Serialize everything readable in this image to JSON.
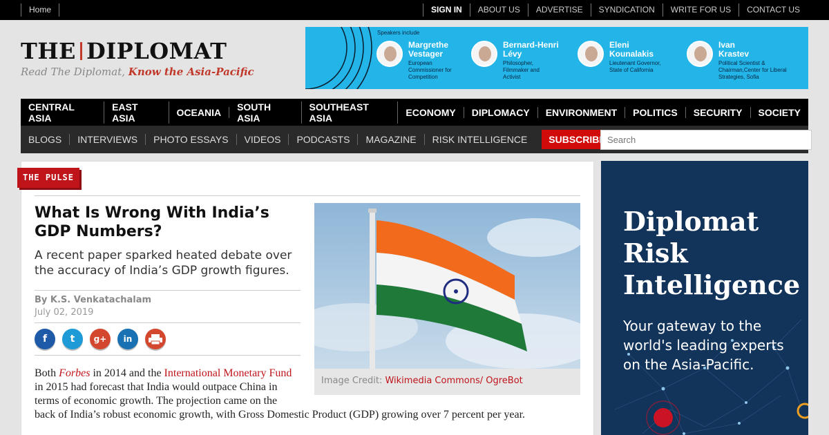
{
  "topbar": {
    "home": "Home",
    "links": [
      "SIGN IN",
      "ABOUT US",
      "ADVERTISE",
      "SYNDICATION",
      "WRITE FOR US",
      "CONTACT US"
    ]
  },
  "logo": {
    "word_left": "THE",
    "word_right": "DIPLOMAT",
    "tagline_plain": "Read The Diplomat, ",
    "tagline_bold": "Know the Asia-Pacific"
  },
  "top_ad": {
    "header": "Speakers include",
    "speakers": [
      {
        "name": "Margrethe Vestager",
        "role": "European Commissioner for Competition"
      },
      {
        "name": "Bernard-Henri Lévy",
        "role": "Philosopher, Filmmaker and Activist"
      },
      {
        "name": "Eleni Kounalakis",
        "role": "Lieutenant Governor, State of California"
      },
      {
        "name": "Ivan Krastev",
        "role": "Political Scientist & Chairman,Center for Liberal Strategies, Sofia"
      }
    ]
  },
  "nav_primary": [
    "CENTRAL ASIA",
    "EAST ASIA",
    "OCEANIA",
    "SOUTH ASIA",
    "SOUTHEAST ASIA",
    "ECONOMY",
    "DIPLOMACY",
    "ENVIRONMENT",
    "POLITICS",
    "SECURITY",
    "SOCIETY"
  ],
  "nav_secondary": [
    "BLOGS",
    "INTERVIEWS",
    "PHOTO ESSAYS",
    "VIDEOS",
    "PODCASTS",
    "MAGAZINE",
    "RISK INTELLIGENCE"
  ],
  "subscribe_label": "SUBSCRIBE",
  "search": {
    "placeholder": "Search"
  },
  "article": {
    "section": "THE PULSE",
    "title": "What Is Wrong With India’s GDP Numbers?",
    "subtitle": "A recent paper sparked heated debate over the accuracy of India’s GDP growth figures.",
    "author": "By K.S. Venkatachalam",
    "date": "July 02, 2019",
    "share_icons": [
      "f",
      "t",
      "g+",
      "in",
      "print"
    ],
    "caption_label": "Image Credit: ",
    "caption_link": "Wikimedia Commons/ OgreBot",
    "body": {
      "p1_a": "Both ",
      "p1_forbes": "Forbes",
      "p1_b": " in 2014 and the ",
      "p1_imf": "International Monetary Fund",
      "p1_c": " in 2015 had forecast that India would outpace China in terms of economic growth. The projection came on the",
      "p1_d": "back of India’s robust economic growth, with Gross Domestic Product (GDP) growing over 7 percent per year."
    }
  },
  "side_ad": {
    "headline_1": "Diplomat",
    "headline_2": "Risk",
    "headline_3": "Intelligence",
    "sub": "Your gateway to the world's leading experts on the Asia-Pacific."
  },
  "colors": {
    "brand_red": "#c0141b",
    "ad_blue": "#23b5e8",
    "ad_navy": "#12335a"
  }
}
